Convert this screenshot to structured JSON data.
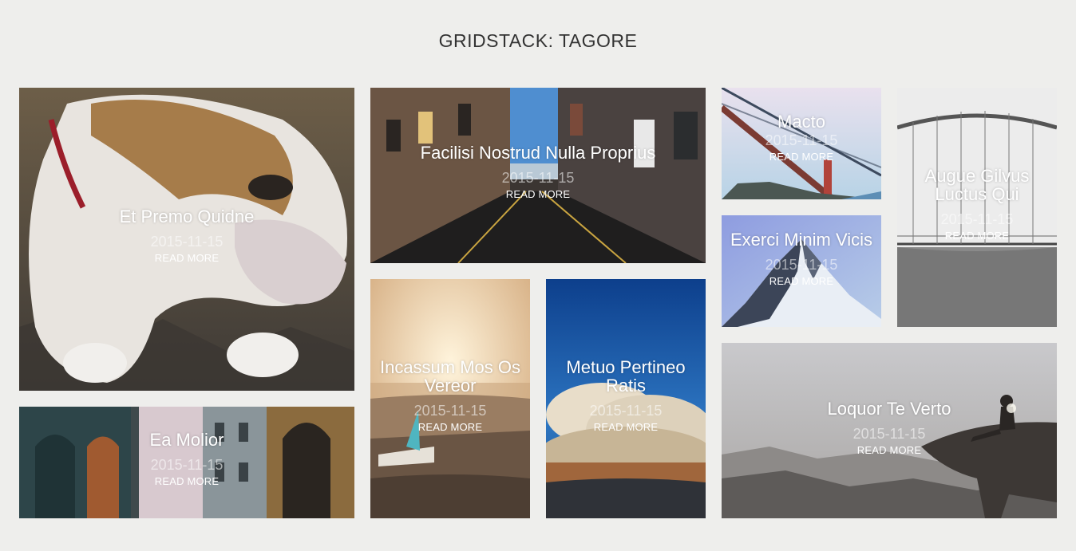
{
  "page": {
    "title": "GRIDSTACK: TAGORE"
  },
  "tiles": [
    {
      "id": "bulldog",
      "title": "Et Premo Quidne",
      "date": "2015-11-15",
      "read_more": "READ MORE"
    },
    {
      "id": "street",
      "title": "Facilisi Nostrud Nulla Proprius",
      "date": "2015-11-15",
      "read_more": "READ MORE"
    },
    {
      "id": "bridge",
      "title": "Macto",
      "date": "2015-11-15",
      "read_more": "READ MORE"
    },
    {
      "id": "suspension-bridge",
      "title": "Augue Gilvus Luctus Qui",
      "date": "2015-11-15",
      "read_more": "READ MORE"
    },
    {
      "id": "mountain",
      "title": "Exerci Minim Vicis",
      "date": "2015-11-15",
      "read_more": "READ MORE"
    },
    {
      "id": "beach",
      "title": "Incassum Mos Os Vereor",
      "date": "2015-11-15",
      "read_more": "READ MORE"
    },
    {
      "id": "clouds",
      "title": "Metuo Pertineo Ratis",
      "date": "2015-11-15",
      "read_more": "READ MORE"
    },
    {
      "id": "alley",
      "title": "Ea Molior",
      "date": "2015-11-15",
      "read_more": "READ MORE"
    },
    {
      "id": "cliff",
      "title": "Loquor Te Verto",
      "date": "2015-11-15",
      "read_more": "READ MORE"
    }
  ]
}
